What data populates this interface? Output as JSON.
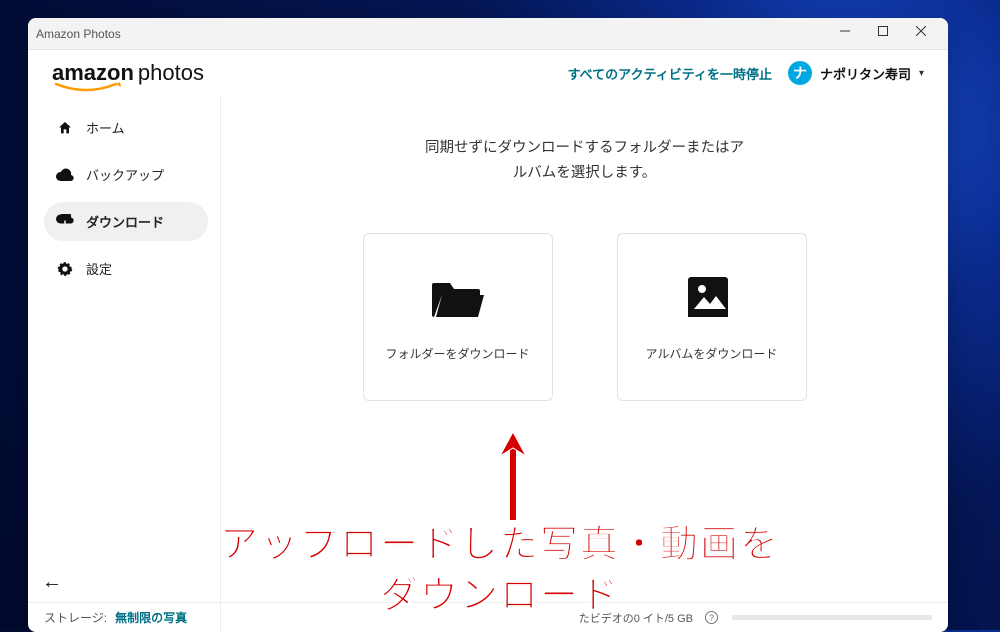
{
  "window": {
    "title": "Amazon Photos"
  },
  "logo": {
    "brand": "amazon",
    "product": "photos"
  },
  "header": {
    "pause_label": "すべてのアクティビティを一時停止",
    "user_name": "ナポリタン寿司",
    "user_initial": "ナ"
  },
  "sidebar": {
    "items": [
      {
        "label": "ホーム"
      },
      {
        "label": "バックアップ"
      },
      {
        "label": "ダウンロード"
      },
      {
        "label": "設定"
      }
    ]
  },
  "main": {
    "instruction_line1": "同期せずにダウンロードするフォルダーまたはア",
    "instruction_line2": "ルバムを選択します。",
    "card_folder_label": "フォルダーをダウンロード",
    "card_album_label": "アルバムをダウンロード"
  },
  "footer": {
    "storage_label": "ストレージ:",
    "storage_value": "無制限の写真",
    "video_usage": "たビデオの0 イト/5 GB"
  },
  "annotation": {
    "line1": "アップロードした写真・動画を",
    "line2": "ダウンロード"
  }
}
